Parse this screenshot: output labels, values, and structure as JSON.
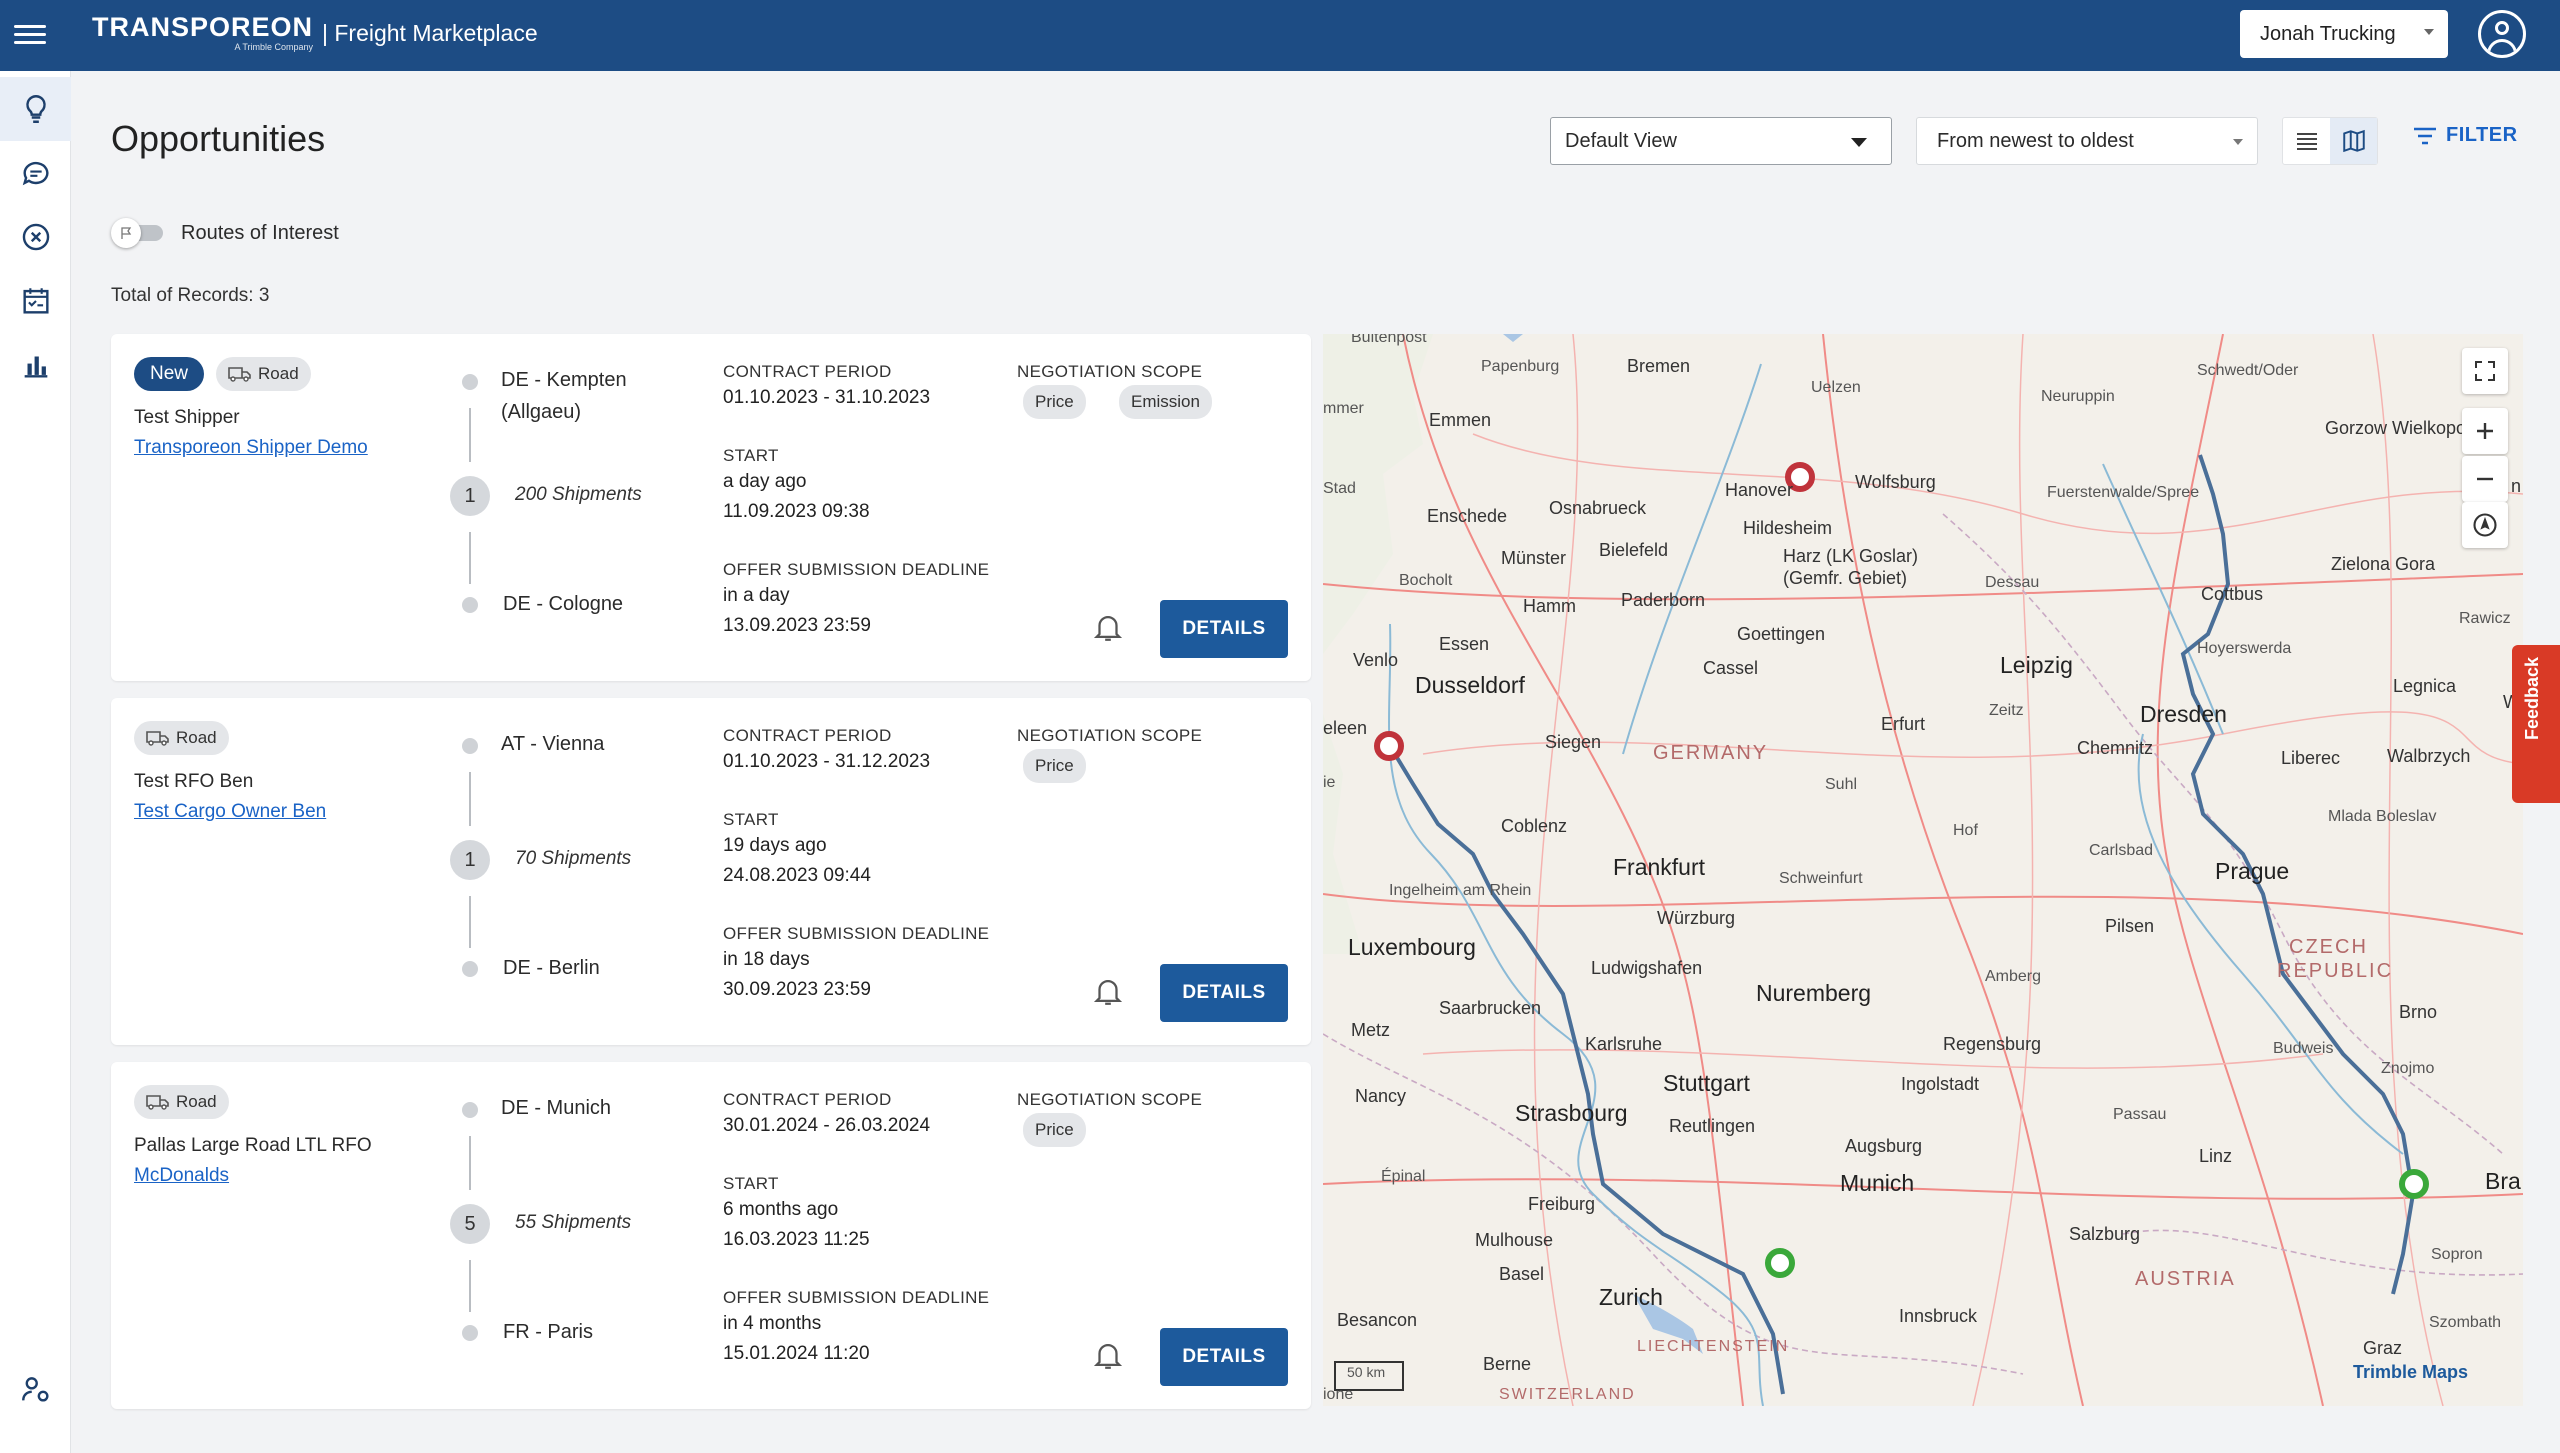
{
  "header": {
    "brand": "TRANSPOREON",
    "brand_sub": "A Trimble Company",
    "app_title": "| Freight Marketplace",
    "company": "Jonah Trucking"
  },
  "page": {
    "title": "Opportunities",
    "view_select": "Default View",
    "sort_select": "From newest to oldest",
    "filter_label": "FILTER",
    "routes_of_interest": "Routes of Interest",
    "total_records": "Total of Records: 3"
  },
  "labels": {
    "contract_period": "CONTRACT PERIOD",
    "negotiation_scope": "NEGOTIATION SCOPE",
    "start": "START",
    "deadline": "OFFER SUBMISSION DEADLINE",
    "details": "DETAILS",
    "road": "Road",
    "new": "New"
  },
  "cards": [
    {
      "is_new": true,
      "shipper": "Test Shipper",
      "shipper_link": "Transporeon Shipper Demo",
      "from_line1": "DE - Kempten",
      "from_line2": "(Allgaeu)",
      "stops": "1",
      "shipments": "200 Shipments",
      "to": "DE - Cologne",
      "contract_period": "01.10.2023 - 31.10.2023",
      "scope": [
        "Price",
        "Emission"
      ],
      "start_rel": "a day ago",
      "start_abs": "11.09.2023 09:38",
      "deadline_rel": "in a day",
      "deadline_abs": "13.09.2023 23:59"
    },
    {
      "is_new": false,
      "shipper": "Test RFO Ben",
      "shipper_link": "Test Cargo Owner Ben",
      "from_line1": "AT - Vienna",
      "from_line2": "",
      "stops": "1",
      "shipments": "70 Shipments",
      "to": "DE - Berlin",
      "contract_period": "01.10.2023 - 31.12.2023",
      "scope": [
        "Price"
      ],
      "start_rel": "19 days ago",
      "start_abs": "24.08.2023 09:44",
      "deadline_rel": "in 18 days",
      "deadline_abs": "30.09.2023 23:59"
    },
    {
      "is_new": false,
      "shipper": "Pallas Large Road LTL RFO",
      "shipper_link": "McDonalds",
      "from_line1": "DE - Munich",
      "from_line2": "",
      "stops": "5",
      "shipments": "55 Shipments",
      "to": "FR - Paris",
      "contract_period": "30.01.2024 - 26.03.2024",
      "scope": [
        "Price"
      ],
      "start_rel": "6 months ago",
      "start_abs": "16.03.2023 11:25",
      "deadline_rel": "in 4 months",
      "deadline_abs": "15.01.2024 11:20"
    }
  ],
  "map": {
    "scale": "50 km",
    "attribution": "Trimble Maps",
    "feedback": "Feedback",
    "labels": {
      "buitenpost": "Buitenpost",
      "papenburg": "Papenburg",
      "bremen": "Bremen",
      "uelzen": "Uelzen",
      "neuruppin": "Neuruppin",
      "schwedt": "Schwedt/Oder",
      "gorzow": "Gorzow Wielkopols",
      "emmen": "Emmen",
      "immer": "mmer",
      "stad": "Stad",
      "enschede": "Enschede",
      "osnabrueck": "Osnabrueck",
      "hanover": "Hanover",
      "wolfsburg": "Wolfsburg",
      "fuerstenwalde": "Fuerstenwalde/Spree",
      "hildesheim": "Hildesheim",
      "zielona": "Zielona Gora",
      "bocholt": "Bocholt",
      "muenster": "Münster",
      "bielefeld": "Bielefeld",
      "harz": "Harz (LK Goslar)",
      "harz2": "(Gemfr. Gebiet)",
      "dessau": "Dessau",
      "cottbus": "Cottbus",
      "hamm": "Hamm",
      "paderborn": "Paderborn",
      "rawicz": "Rawicz",
      "essen": "Essen",
      "goettingen": "Goettingen",
      "hoyerswerda": "Hoyerswerda",
      "venlo": "Venlo",
      "cassel": "Cassel",
      "leipzig": "Leipzig",
      "legnica": "Legnica",
      "dusseldorf": "Dusseldorf",
      "dresden": "Dresden",
      "zeitz": "Zeitz",
      "erfurt": "Erfurt",
      "leleen": "eleen",
      "siegen": "Siegen",
      "germany": "GERMANY",
      "chemnitz": "Chemnitz",
      "liberec": "Liberec",
      "walbrzych": "Walbrzych",
      "suhl": "Suhl",
      "mlada": "Mlada Boleslav",
      "coblenz": "Coblenz",
      "hof": "Hof",
      "frankfurt": "Frankfurt",
      "carlsbad": "Carlsbad",
      "schweinfurt": "Schweinfurt",
      "prague": "Prague",
      "ingelheim": "Ingelheim am Rhein",
      "luxembourg": "Luxembourg",
      "wuerzburg": "Würzburg",
      "pilsen": "Pilsen",
      "czech": "CZECH",
      "republic": "REPUBLIC",
      "ludwigshafen": "Ludwigshafen",
      "amberg": "Amberg",
      "nuremberg": "Nuremberg",
      "brno": "Brno",
      "saarbrucken": "Saarbrucken",
      "metz": "Metz",
      "karlsruhe": "Karlsruhe",
      "regensburg": "Regensburg",
      "budweis": "Budweis",
      "znojmo": "Znojmo",
      "stuttgart": "Stuttgart",
      "ingolstadt": "Ingolstadt",
      "nancy": "Nancy",
      "strasbourg": "Strasbourg",
      "reutlingen": "Reutlingen",
      "passau": "Passau",
      "augsburg": "Augsburg",
      "munich": "Munich",
      "linz": "Linz",
      "epinal": "Épinal",
      "freiburg": "Freiburg",
      "bra": "Bra",
      "mulhouse": "Mulhouse",
      "salzburg": "Salzburg",
      "basel": "Basel",
      "sopron": "Sopron",
      "austria": "AUSTRIA",
      "zurich": "Zurich",
      "besancon": "Besancon",
      "innsbruck": "Innsbruck",
      "szombath": "Szombath",
      "liechtenstein": "LIECHTENSTEIN",
      "graz": "Graz",
      "berne": "Berne",
      "switzerland": "SWITZERLAND",
      "wr": "Wr",
      "ie": "ie",
      "ione": "ione",
      "n": "n"
    }
  },
  "colors": {
    "header_bg": "#1d4c84",
    "accent": "#1a63c6",
    "route": "#4a6f98",
    "origin_marker": "#c0333b",
    "dest_marker": "#3aa83a"
  }
}
